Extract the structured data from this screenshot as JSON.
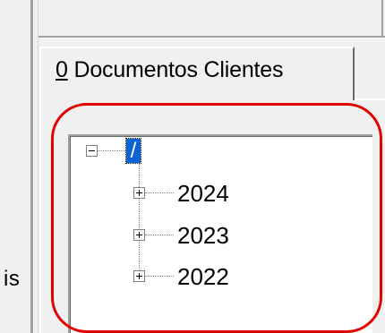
{
  "left_panel": {
    "text": "is"
  },
  "tabs": [
    {
      "hotkey": "0",
      "rest": " Documentos Clientes"
    }
  ],
  "tree": {
    "root": {
      "label": "/",
      "expander": "minus"
    },
    "children": [
      {
        "label": "2024",
        "expander": "plus"
      },
      {
        "label": "2023",
        "expander": "plus"
      },
      {
        "label": "2022",
        "expander": "plus"
      }
    ]
  },
  "colors": {
    "selection": "#0a64d8",
    "annotation": "#e00000",
    "window_bg": "#f0f0f0"
  },
  "icons": {
    "collapse": "minus-box-icon",
    "expand": "plus-box-icon"
  }
}
